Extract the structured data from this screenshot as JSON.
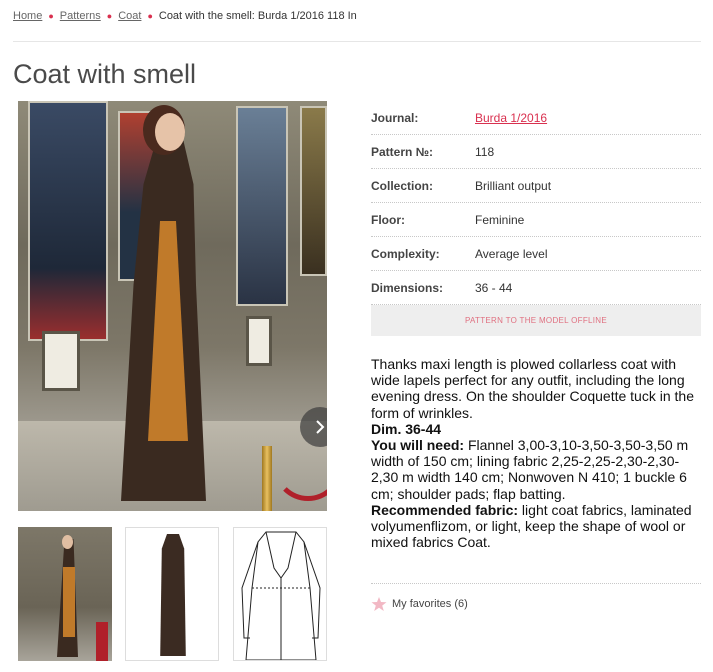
{
  "breadcrumb": {
    "items": [
      "Home",
      "Patterns",
      "Coat"
    ],
    "current": "Coat with the smell: Burda 1/2016 118 In"
  },
  "page": {
    "title": "Coat with smell"
  },
  "info": {
    "rows": [
      {
        "label": "Journal:",
        "value": "Burda 1/2016"
      },
      {
        "label": "Pattern №:",
        "value": "118"
      },
      {
        "label": "Collection:",
        "value": "Brilliant output"
      },
      {
        "label": "Floor:",
        "value": "Feminine"
      },
      {
        "label": "Complexity:",
        "value": "Average level"
      },
      {
        "label": "Dimensions:",
        "value": "36 - 44"
      }
    ],
    "offline_button": "PATTERN TO THE MODEL OFFLINE"
  },
  "description": {
    "intro": "Thanks maxi length is plowed collarless coat with wide lapels perfect for any outfit, including the long evening dress. On the shoulder Coquette tuck in the form of wrinkles.",
    "dim": "Dim. 36-44",
    "need_label": "You will need:",
    "need_text": " Flannel 3,00-3,10-3,50-3,50-3,50 m width of 150 cm; lining fabric 2,25-2,25-2,30-2,30-2,30 m width 140 cm; Nonwoven N 410; 1 buckle 6 cm; shoulder pads; flap batting.",
    "fabric_label": "Recommended fabric:",
    "fabric_text": " light coat fabrics, laminated volyumenflizom, or light, keep the shape of wool or mixed fabrics Coat."
  },
  "favorites": {
    "label": "My favorites (6)"
  },
  "colors": {
    "accent": "#d9304f",
    "star": "#f2b8c4"
  },
  "icons": {
    "next": "chevron-right-icon",
    "favorite": "star-icon"
  }
}
